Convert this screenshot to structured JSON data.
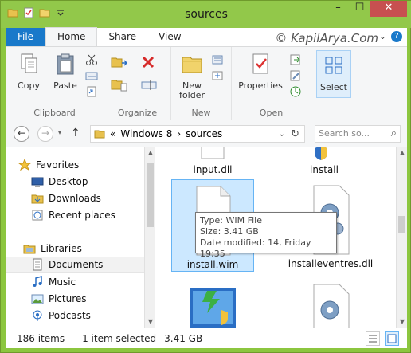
{
  "window": {
    "title": "sources",
    "controls": {
      "minimize": "–",
      "maximize": "☐",
      "close": "✕"
    }
  },
  "tabs": [
    {
      "label": "File"
    },
    {
      "label": "Home"
    },
    {
      "label": "Share"
    },
    {
      "label": "View"
    }
  ],
  "watermark": "© KapilArya.Com",
  "help_label": "?",
  "ribbon": {
    "clipboard": {
      "label": "Clipboard",
      "copy": "Copy",
      "paste": "Paste"
    },
    "organize": {
      "label": "Organize"
    },
    "new": {
      "label": "New",
      "new_folder": "New\nfolder"
    },
    "open": {
      "label": "Open",
      "properties": "Properties"
    },
    "select": {
      "label": "Select"
    }
  },
  "address": {
    "back": "←",
    "forward": "→",
    "up": "↑",
    "prefix": "«",
    "segments": [
      "Windows 8",
      "sources"
    ],
    "separator": "›",
    "dropdown": "⌄",
    "refresh": "↻",
    "search_placeholder": "Search so...",
    "search_icon": "⌕"
  },
  "nav": {
    "favorites": "Favorites",
    "desktop": "Desktop",
    "downloads": "Downloads",
    "recent": "Recent places",
    "libraries": "Libraries",
    "documents": "Documents",
    "music": "Music",
    "pictures": "Pictures",
    "podcasts": "Podcasts"
  },
  "files": [
    {
      "name": "input.dll"
    },
    {
      "name": "install"
    },
    {
      "name": "install.wim"
    },
    {
      "name": "installeventres.dll"
    }
  ],
  "tooltip": {
    "type": "Type: WIM File",
    "size": "Size: 3.41 GB",
    "modified": "Date modified: 14, Friday 19:35"
  },
  "status": {
    "count": "186 items",
    "selected": "1 item selected",
    "size": "3.41 GB"
  },
  "colors": {
    "accent": "#1979ca",
    "titlebar": "#92c84a",
    "selection": "#cce8ff"
  }
}
